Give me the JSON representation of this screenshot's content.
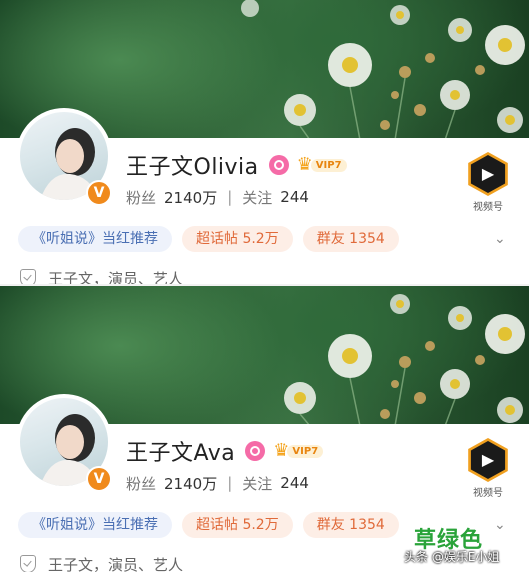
{
  "profiles": [
    {
      "name": "王子文Olivia",
      "vip_label": "VIP7",
      "stats": {
        "fans_label": "粉丝",
        "fans_value": "2140万",
        "follow_label": "关注",
        "follow_value": "244"
      },
      "tags": [
        {
          "label": "《听姐说》当红推荐",
          "style": "blue"
        },
        {
          "label": "超话帖 5.2万",
          "style": "orange"
        },
        {
          "label": "群友 1354",
          "style": "orange"
        }
      ],
      "video_label": "视频号",
      "info": "王子文，演员、艺人"
    },
    {
      "name": "王子文Ava",
      "vip_label": "VIP7",
      "stats": {
        "fans_label": "粉丝",
        "fans_value": "2140万",
        "follow_label": "关注",
        "follow_value": "244"
      },
      "tags": [
        {
          "label": "《听姐说》当红推荐",
          "style": "blue"
        },
        {
          "label": "超话帖 5.2万",
          "style": "orange"
        },
        {
          "label": "群友 1354",
          "style": "orange"
        }
      ],
      "video_label": "视频号",
      "info": "王子文，演员、艺人"
    }
  ],
  "watermark": {
    "big": "草绿色",
    "small": "头条 @娱乐E小姐"
  },
  "colors": {
    "tag_blue_text": "#4a6fb3",
    "tag_orange_text": "#e06a3a",
    "vip_gold": "#f4a31b",
    "watermark_green": "#2aa33a"
  }
}
